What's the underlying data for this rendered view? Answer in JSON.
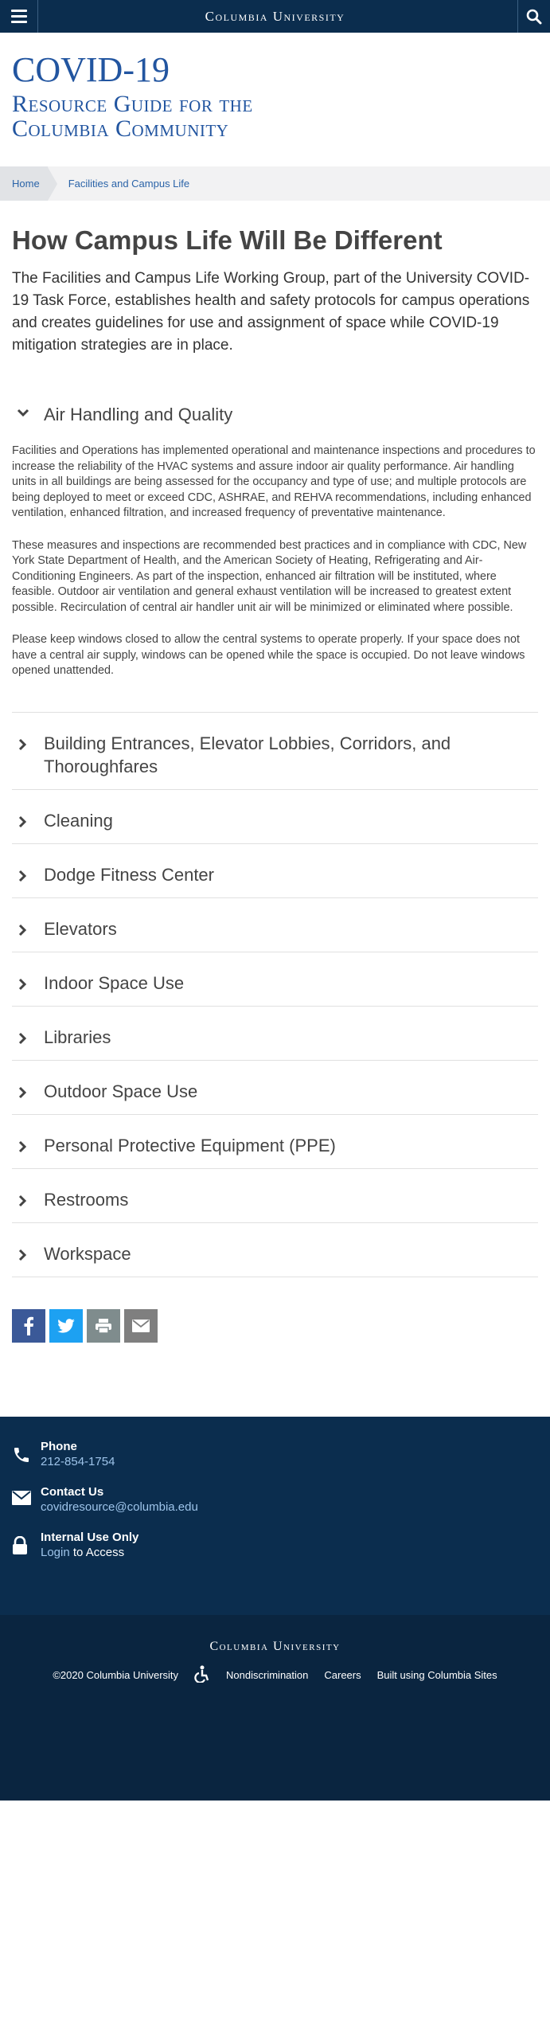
{
  "topbar": {
    "brand": "Columbia University",
    "menu_icon": "hamburger-menu-icon",
    "search_icon": "search-icon"
  },
  "header": {
    "title": "COVID-19",
    "subtitle_line1": "Resource Guide for the",
    "subtitle_line2": "Columbia Community"
  },
  "breadcrumb": {
    "home": "Home",
    "current": "Facilities and Campus Life"
  },
  "page": {
    "title": "How Campus Life Will Be Different",
    "intro": "The Facilities and Campus Life Working Group, part of the University COVID-19 Task Force, establishes health and safety protocols for campus operations and creates guidelines for use and assignment of space while COVID-19 mitigation strategies are in place."
  },
  "accordion": {
    "open": {
      "label": "Air Handling and Quality",
      "paragraphs": [
        "Facilities and Operations has implemented operational and maintenance inspections and procedures to increase the reliability of the HVAC systems and assure indoor air quality performance. Air handling units in all buildings are being assessed for the occupancy and type of use; and multiple protocols are being deployed to meet or exceed CDC, ASHRAE, and REHVA recommendations, including enhanced ventilation, enhanced filtration, and increased frequency of preventative maintenance.",
        "These measures and inspections are recommended best practices and in compliance with CDC, New York State Department of Health, and the American Society of Heating, Refrigerating and Air-Conditioning Engineers. As part of the inspection, enhanced air filtration will be instituted, where feasible. Outdoor air ventilation and general exhaust ventilation will be increased to greatest extent possible. Recirculation of central air handler unit air will be minimized or eliminated where possible.",
        "Please keep windows closed to allow the central systems to operate properly. If your space does not have a central air supply, windows can be opened while the space is occupied. Do not leave windows opened unattended."
      ]
    },
    "items": [
      "Building Entrances, Elevator Lobbies, Corridors, and Thoroughfares",
      "Cleaning",
      "Dodge Fitness Center",
      "Elevators",
      "Indoor Space Use",
      "Libraries",
      "Outdoor Space Use",
      "Personal Protective Equipment (PPE)",
      "Restrooms",
      "Workspace"
    ]
  },
  "share": {
    "buttons": [
      {
        "name": "facebook",
        "icon": "facebook-icon",
        "color": "#3b5998"
      },
      {
        "name": "twitter",
        "icon": "twitter-icon",
        "color": "#1da1f2"
      },
      {
        "name": "print",
        "icon": "print-icon",
        "color": "#7f8c8d"
      },
      {
        "name": "email",
        "icon": "email-icon",
        "color": "#7f7f7f"
      }
    ]
  },
  "footer": {
    "phone_title": "Phone",
    "phone": "212-854-1754",
    "contact_title": "Contact Us",
    "email": "covidresource@columbia.edu",
    "internal_title": "Internal Use Only",
    "login": "Login",
    "login_suffix": " to Access",
    "brand": "Columbia University",
    "copyright": "©2020 Columbia University",
    "accessibility_icon": "accessibility-icon",
    "nondiscrimination": "Nondiscrimination",
    "careers": "Careers",
    "built": "Built using Columbia Sites"
  },
  "colors": {
    "navy": "#0b2d4e",
    "title_blue": "#2255a0",
    "link_blue": "#2a63a8"
  }
}
